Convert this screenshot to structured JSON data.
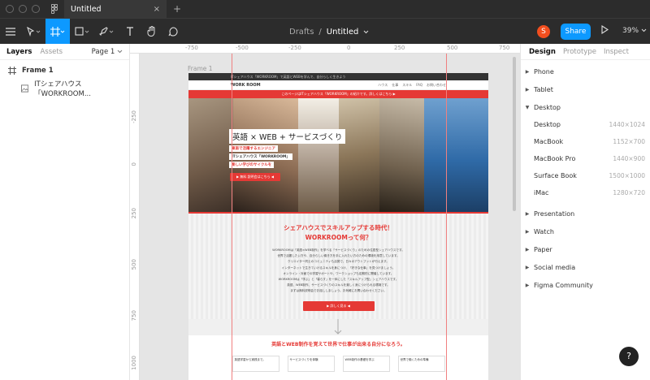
{
  "app": {
    "tab_title": "Untitled",
    "tab_close": "×",
    "new_tab": "+"
  },
  "toolbar": {
    "breadcrumb_parent": "Drafts",
    "breadcrumb_sep": "/",
    "file_name": "Untitled",
    "avatar_letter": "S",
    "share_label": "Share",
    "zoom_label": "39%"
  },
  "left_panel": {
    "tabs": [
      "Layers",
      "Assets"
    ],
    "page_selector": "Page 1",
    "layers": [
      {
        "name": "Frame 1"
      },
      {
        "name": "ITシェアハウス「WORKROOM..."
      }
    ]
  },
  "rulers": {
    "top": [
      "-750",
      "-500",
      "-250",
      "0",
      "250",
      "500",
      "750"
    ],
    "left": [
      "-250",
      "0",
      "250",
      "500",
      "750",
      "1000"
    ]
  },
  "canvas": {
    "frame_label": "Frame 1",
    "site": {
      "topbar_text": "ITシェアハウス「WORKROOM」で英語とWEBを学んで、自分らしく生きよう",
      "nav_logo": "WORK ROOM",
      "nav_links": [
        "ハウス",
        "仕事",
        "スキル",
        "FAQ",
        "お問い合わせ"
      ],
      "red_bar": "このページはITシェアハウス「WORKROOM」の紹介です。詳しくはこちら ▶",
      "hero_title": "英語 × WEB + サービスづくり",
      "hero_tags": [
        "東南で活躍するエンジニア",
        "ITシェアハウス「WORKROOM」",
        "楽しい学びのサイクルを"
      ],
      "hero_cta": "▶ 無料 説明会はこちら ◀",
      "sec1_title_a": "シェアハウスでスキルアップする時代！",
      "sec1_title_b": "WORKROOMって何？",
      "sec1_lines": [
        "WORKROOMは「英語×WEB制作」を学べる「サービスづくり」のための住居型シェアハウスです。",
        "世界で活躍したい方や、自分らしい働き方を手に入れたい方のための環境を用意しています。",
        "クリエイター同士のコミュニティも活発で、日々のアウトプットが行えます。",
        "インターネットで生きていけるスキルを身につけ、「好きな仕事」を見つけましょう。",
        "オンライン・対面での学習サポートや、ワークショップも定期的に開催しています。",
        "WORKROOMは「学ぶ」と「暮らす」を一体にした「スキルアップ型」シェアハウスです。",
        "英語、WEB制作、サービスづくりのスキルを楽しく身につけられる環境です。",
        "まずは無料説明会でお話ししましょう。お気軽にお問い合わせください。"
      ],
      "sec1_cta": "▶ 詳しく見る ◀",
      "sec2_title": "英語とWEB制作を覚えて世界で仕事が出来る自分になろう。",
      "cards": [
        "英語学習から実践まで。",
        "サービスづくりを体験",
        "WEB制作の基礎を学ぶ",
        "世界で働くための準備"
      ]
    }
  },
  "right_panel": {
    "tabs": [
      "Design",
      "Prototype",
      "Inspect"
    ],
    "categories": [
      {
        "label": "Phone",
        "open": false
      },
      {
        "label": "Tablet",
        "open": false
      },
      {
        "label": "Desktop",
        "open": true
      },
      {
        "label": "Presentation",
        "open": false
      },
      {
        "label": "Watch",
        "open": false
      },
      {
        "label": "Paper",
        "open": false
      },
      {
        "label": "Social media",
        "open": false
      },
      {
        "label": "Figma Community",
        "open": false
      }
    ],
    "desktop_presets": [
      {
        "name": "Desktop",
        "size": "1440×1024"
      },
      {
        "name": "MacBook",
        "size": "1152×700"
      },
      {
        "name": "MacBook Pro",
        "size": "1440×900"
      },
      {
        "name": "Surface Book",
        "size": "1500×1000"
      },
      {
        "name": "iMac",
        "size": "1280×720"
      }
    ]
  },
  "help_label": "?",
  "colors": {
    "figma_blue": "#0d99ff",
    "dark_chrome": "#2c2c2c",
    "site_red": "#e53935",
    "avatar": "#f24e1e"
  }
}
